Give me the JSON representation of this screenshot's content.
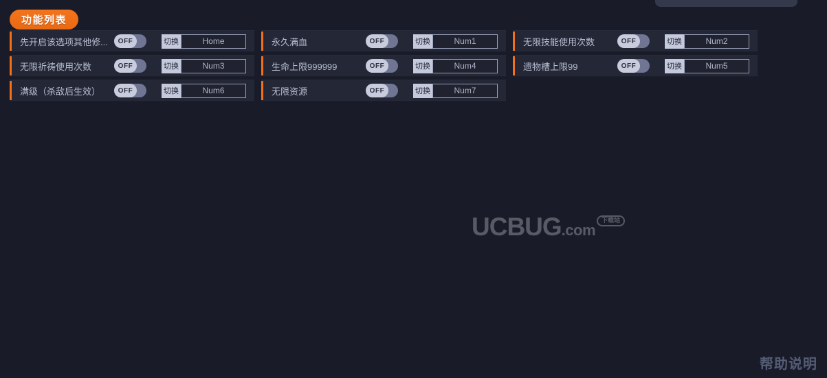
{
  "window": {
    "background_color": "#191c28",
    "accent_color": "#f4711a"
  },
  "top_bar": {
    "partial_pill_color": "#343a4c"
  },
  "panel": {
    "title": "功能列表"
  },
  "toggle": {
    "off_label": "OFF"
  },
  "hotkey": {
    "tag_label": "切换"
  },
  "columns": [
    {
      "rows": [
        {
          "label": "先开启该选项其他修...",
          "state": "OFF",
          "tag": "切换",
          "key": "Home"
        },
        {
          "label": "无限祈祷使用次数",
          "state": "OFF",
          "tag": "切换",
          "key": "Num3"
        },
        {
          "label": "满级（杀敌后生效）",
          "state": "OFF",
          "tag": "切换",
          "key": "Num6"
        }
      ]
    },
    {
      "rows": [
        {
          "label": "永久满血",
          "state": "OFF",
          "tag": "切换",
          "key": "Num1"
        },
        {
          "label": "生命上限999999",
          "state": "OFF",
          "tag": "切换",
          "key": "Num4"
        },
        {
          "label": "无限资源",
          "state": "OFF",
          "tag": "切换",
          "key": "Num7"
        }
      ]
    },
    {
      "rows": [
        {
          "label": "无限技能使用次数",
          "state": "OFF",
          "tag": "切换",
          "key": "Num2"
        },
        {
          "label": "遗物槽上限99",
          "state": "OFF",
          "tag": "切换",
          "key": "Num5"
        }
      ]
    }
  ],
  "watermark": {
    "brand": "UCBUG",
    "suffix": ".com",
    "badge": "下载站"
  },
  "footer": {
    "help_label": "帮助说明"
  }
}
